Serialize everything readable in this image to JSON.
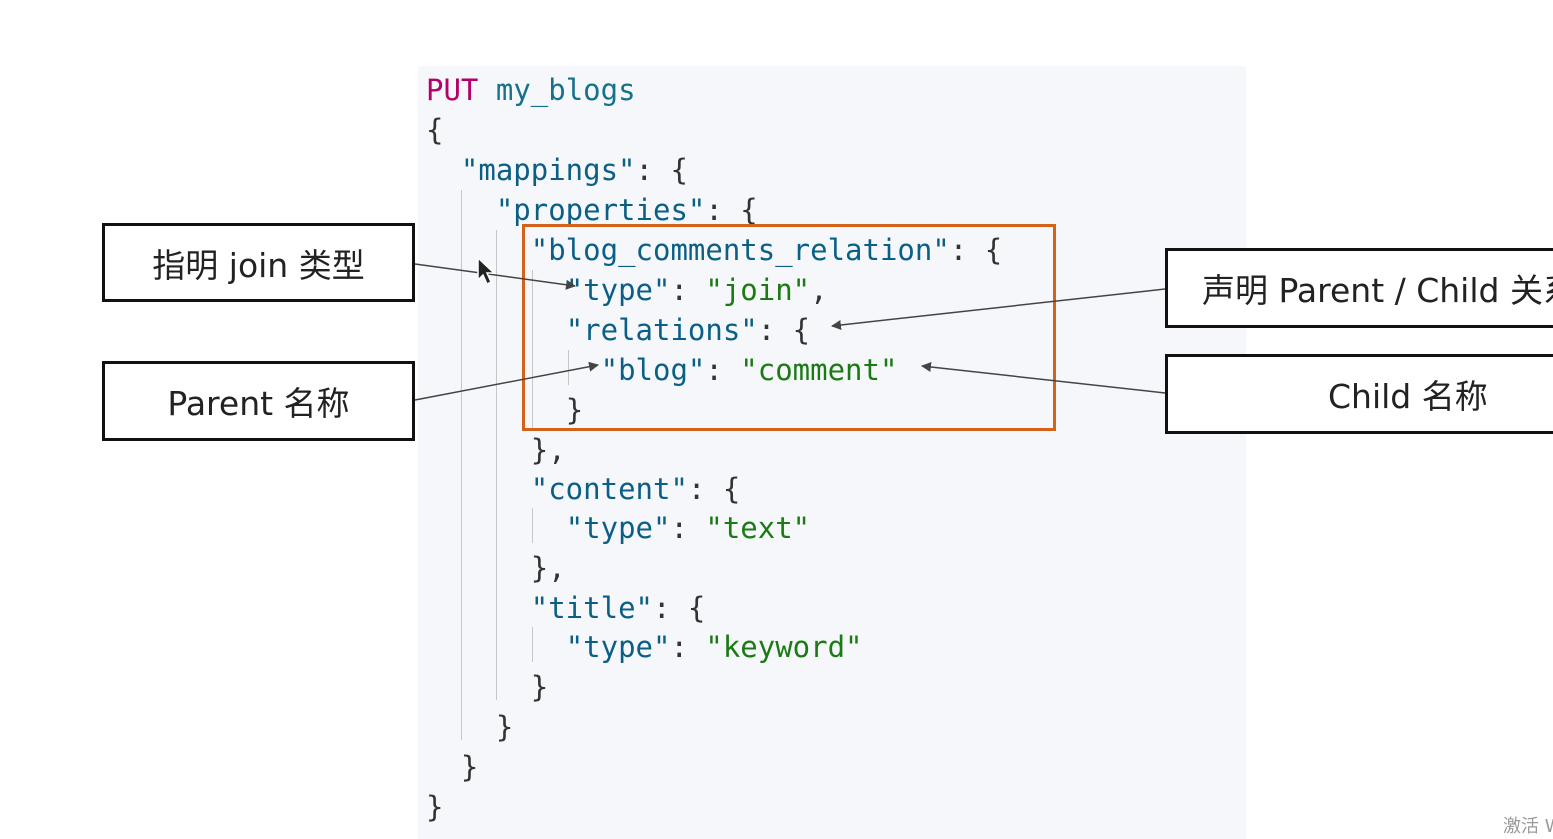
{
  "code": {
    "method": "PUT",
    "index": "my_blogs",
    "keys": {
      "mappings": "\"mappings\"",
      "properties": "\"properties\"",
      "relation_field": "\"blog_comments_relation\"",
      "type": "\"type\"",
      "relations": "\"relations\"",
      "blog": "\"blog\"",
      "content": "\"content\"",
      "title": "\"title\""
    },
    "values": {
      "join": "\"join\"",
      "comment": "\"comment\"",
      "text": "\"text\"",
      "keyword": "\"keyword\""
    }
  },
  "callouts": {
    "join_type": "指明 join 类型",
    "parent_name": "Parent 名称",
    "declare_relation": "声明 Parent / Child 关系",
    "child_name": "Child 名称"
  },
  "colors": {
    "highlight_box": "#d4621a",
    "method": "#b5006b",
    "key": "#0b5f86",
    "string": "#1c7a14"
  },
  "watermark": "激活 Windows"
}
